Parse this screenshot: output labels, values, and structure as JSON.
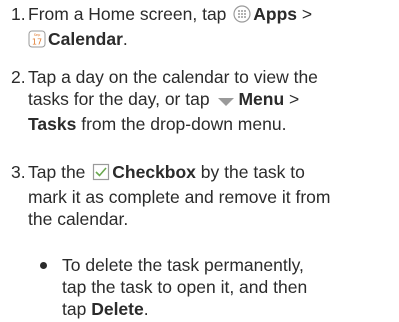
{
  "steps": [
    {
      "num": "1.",
      "pre": "From a Home screen, tap",
      "apps_label": "Apps",
      "sep": ">",
      "calendar_icon_top": "Sep",
      "calendar_icon_day": "17",
      "calendar_label": "Calendar",
      "end": "."
    },
    {
      "num": "2.",
      "line1": "Tap a day on the calendar to view the",
      "line2_pre": "tasks for the day, or tap",
      "menu_label": "Menu",
      "sep": ">",
      "tasks_label": "Tasks",
      "line3_post": "from the drop-down menu."
    },
    {
      "num": "3.",
      "pre": "Tap the",
      "checkbox_label": "Checkbox",
      "line1_post": "by the task to",
      "line2": "mark it as complete and remove it from",
      "line3": "the calendar."
    }
  ],
  "bullet": {
    "line1": "To delete the task permanently,",
    "line2": "tap the task to open it, and then",
    "line3_pre": "tap",
    "delete_label": "Delete",
    "end": "."
  },
  "colors": {
    "text": "#2b2b2b",
    "icon_gray": "#9a9a9a",
    "calendar_accent": "#e07a2e",
    "checkbox_green": "#6aa84f"
  }
}
